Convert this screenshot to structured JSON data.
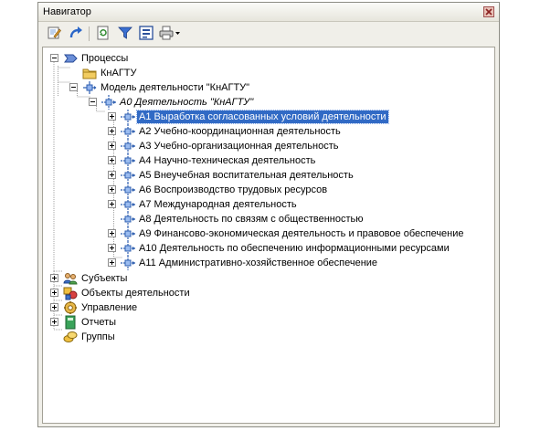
{
  "window": {
    "title": "Навигатор"
  },
  "toolbar": {
    "buttons": [
      {
        "icon": "edit-icon"
      },
      {
        "icon": "redo-arrow-icon"
      },
      {
        "icon": "refresh-document-icon"
      },
      {
        "icon": "filter-funnel-icon"
      },
      {
        "icon": "select-list-icon"
      },
      {
        "icon": "printer-dropdown-icon"
      }
    ]
  },
  "tree": {
    "root": {
      "label": "Процессы"
    },
    "org": {
      "label": "КнАГТУ"
    },
    "model": {
      "label": "Модель деятельности \"КнАГТУ\""
    },
    "a0": {
      "label": "A0 Деятельность \"КнАГТУ\""
    },
    "activities": [
      {
        "label": "A1 Выработка согласованных условий деятельности",
        "selected": true,
        "expandable": true
      },
      {
        "label": "A2 Учебно-координационная деятельность",
        "expandable": true
      },
      {
        "label": "A3 Учебно-организационная деятельность",
        "expandable": true
      },
      {
        "label": "A4 Научно-техническая деятельность",
        "expandable": true
      },
      {
        "label": "A5 Внеучебная воспитательная деятельность",
        "expandable": true
      },
      {
        "label": "A6 Воспроизводство трудовых ресурсов",
        "expandable": true
      },
      {
        "label": "A7 Международная деятельность",
        "expandable": true
      },
      {
        "label": "A8 Деятельность по связям с общественностью",
        "expandable": false
      },
      {
        "label": "A9 Финансово-экономическая деятельность и правовое обеспечение",
        "expandable": true
      },
      {
        "label": "A10 Деятельность по обеспечению информационными ресурсами",
        "expandable": true
      },
      {
        "label": "A11 Административно-хозяйственное обеспечение",
        "expandable": true
      }
    ],
    "subjects": {
      "label": "Субъекты"
    },
    "objects": {
      "label": "Объекты деятельности"
    },
    "control": {
      "label": "Управление"
    },
    "reports": {
      "label": "Отчеты"
    },
    "groups": {
      "label": "Группы"
    }
  },
  "colors": {
    "selection": "#316ac5",
    "activity_icon": "#2f5fb0"
  }
}
